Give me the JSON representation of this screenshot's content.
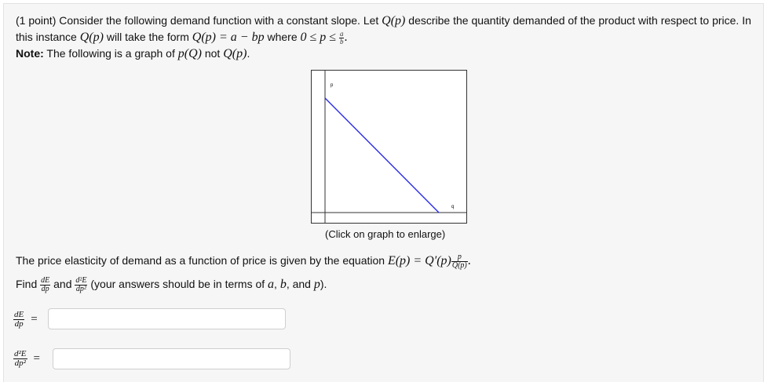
{
  "problem": {
    "points_label": "(1 point)",
    "intro_text": "Consider the following demand function with a constant slope. Let",
    "Qp": "Q(p)",
    "intro_text2": "describe the quantity demanded of the product with respect to price. In",
    "line2_text": "this instance",
    "line2_text2": "will take the form",
    "form_expr": "Q(p) = a − bp",
    "where_text": "where",
    "range_expr_start": "0 ≤ p ≤",
    "a_over_b_num": "a",
    "a_over_b_den": "b",
    "period": ".",
    "note_bold": "Note:",
    "note_text": "The following is a graph of",
    "note_pQ": "p(Q)",
    "note_not": "not",
    "note_Qp": "Q(p)",
    "note_period": "."
  },
  "graph": {
    "p_axis_label": "p",
    "q_axis_label": "q",
    "caption": "(Click on graph to enlarge)",
    "line_color": "#2a2ae6"
  },
  "elasticity": {
    "text": "The price elasticity of demand as a function of price is given by the equation",
    "expr_left": "E(p) = Q′(p)",
    "frac_num": "p",
    "frac_den": "Q(p)",
    "period": "."
  },
  "instruction": {
    "find": "Find",
    "d1_num": "dE",
    "d1_den": "dp",
    "and1": "and",
    "d2_num": "d²E",
    "d2_den": "dp²",
    "tail": "(your answers should be in terms of",
    "var_a": "a",
    "comma1": ",",
    "var_b": "b",
    "and2": ", and",
    "var_p": "p",
    "close": ")."
  },
  "answers": {
    "first_num": "dE",
    "first_den": "dp",
    "second_num": "d²E",
    "second_den": "dp²",
    "equals": "=",
    "first_value": "",
    "second_value": ""
  }
}
